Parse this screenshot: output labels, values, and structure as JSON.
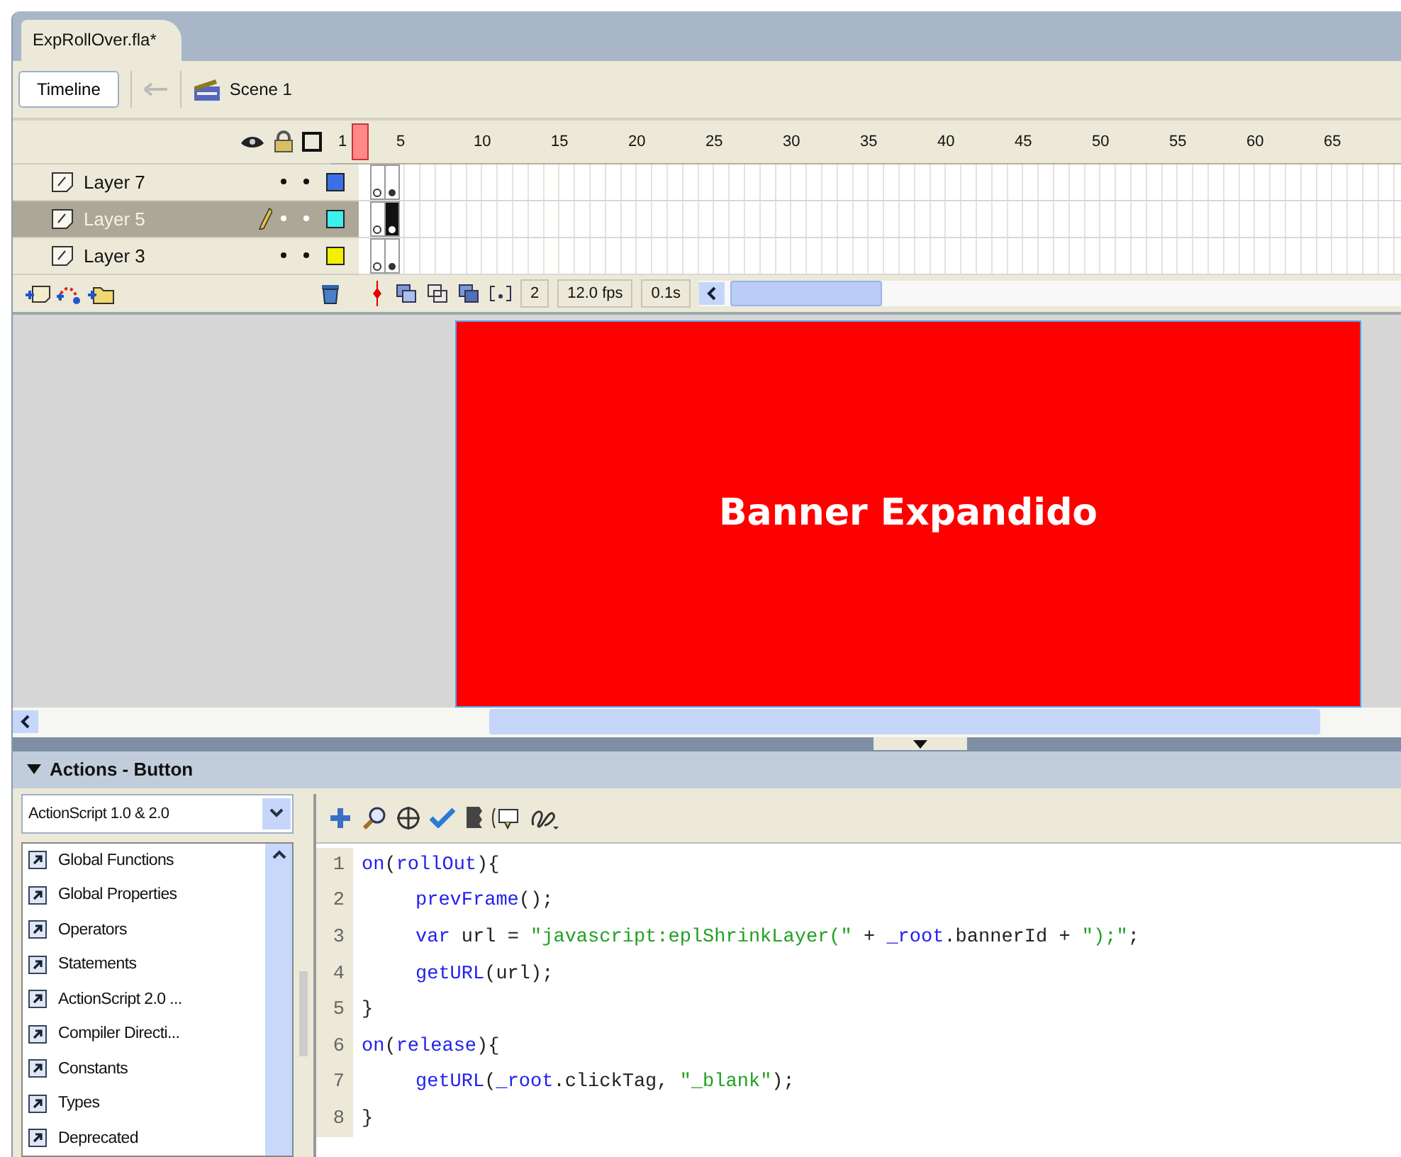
{
  "document_tab": {
    "title": "ExpRollOver.fla*"
  },
  "edit_bar": {
    "timeline_button": "Timeline",
    "scene": "Scene 1"
  },
  "timeline": {
    "ruler": [
      "1",
      "5",
      "10",
      "15",
      "20",
      "25",
      "30",
      "35",
      "40",
      "45",
      "50",
      "55",
      "60",
      "65"
    ],
    "layers": [
      {
        "name": "Layer 7",
        "selected": false,
        "color": "#3b6fe8"
      },
      {
        "name": "Layer 5",
        "selected": true,
        "color": "#3cf0f0"
      },
      {
        "name": "Layer 3",
        "selected": false,
        "color": "#f4f000"
      }
    ],
    "current_frame": "2",
    "frame_rate": "12.0 fps",
    "elapsed_time": "0.1s"
  },
  "stage": {
    "text": "Banner Expandido"
  },
  "actions_panel": {
    "title": "Actions - Button",
    "language": "ActionScript 1.0 & 2.0",
    "toolbox": [
      "Global Functions",
      "Global Properties",
      "Operators",
      "Statements",
      "ActionScript 2.0 ...",
      "Compiler Directi...",
      "Constants",
      "Types",
      "Deprecated"
    ],
    "code": [
      {
        "number": "1",
        "indented": false,
        "tokens": [
          {
            "kind": "keyword",
            "text": "on"
          },
          {
            "kind": "plain",
            "text": "("
          },
          {
            "kind": "keyword",
            "text": "rollOut"
          },
          {
            "kind": "plain",
            "text": "){"
          }
        ]
      },
      {
        "number": "2",
        "indented": true,
        "tokens": [
          {
            "kind": "keyword",
            "text": "prevFrame"
          },
          {
            "kind": "plain",
            "text": "();"
          }
        ]
      },
      {
        "number": "3",
        "indented": true,
        "tokens": [
          {
            "kind": "keyword",
            "text": "var"
          },
          {
            "kind": "plain",
            "text": " url = "
          },
          {
            "kind": "string",
            "text": "\"javascript:eplShrinkLayer(\""
          },
          {
            "kind": "plain",
            "text": " + "
          },
          {
            "kind": "keyword",
            "text": "_root"
          },
          {
            "kind": "plain",
            "text": ".bannerId + "
          },
          {
            "kind": "string",
            "text": "\");\""
          },
          {
            "kind": "plain",
            "text": ";"
          }
        ]
      },
      {
        "number": "4",
        "indented": true,
        "tokens": [
          {
            "kind": "keyword",
            "text": "getURL"
          },
          {
            "kind": "plain",
            "text": "(url);"
          }
        ]
      },
      {
        "number": "5",
        "indented": false,
        "tokens": [
          {
            "kind": "plain",
            "text": "}"
          }
        ]
      },
      {
        "number": "6",
        "indented": false,
        "tokens": [
          {
            "kind": "keyword",
            "text": "on"
          },
          {
            "kind": "plain",
            "text": "("
          },
          {
            "kind": "keyword",
            "text": "release"
          },
          {
            "kind": "plain",
            "text": "){"
          }
        ]
      },
      {
        "number": "7",
        "indented": true,
        "tokens": [
          {
            "kind": "keyword",
            "text": "getURL"
          },
          {
            "kind": "plain",
            "text": "("
          },
          {
            "kind": "keyword",
            "text": "_root"
          },
          {
            "kind": "plain",
            "text": ".clickTag, "
          },
          {
            "kind": "string",
            "text": "\"_blank\""
          },
          {
            "kind": "plain",
            "text": ");"
          }
        ]
      },
      {
        "number": "8",
        "indented": false,
        "tokens": [
          {
            "kind": "plain",
            "text": "}"
          }
        ]
      }
    ]
  }
}
